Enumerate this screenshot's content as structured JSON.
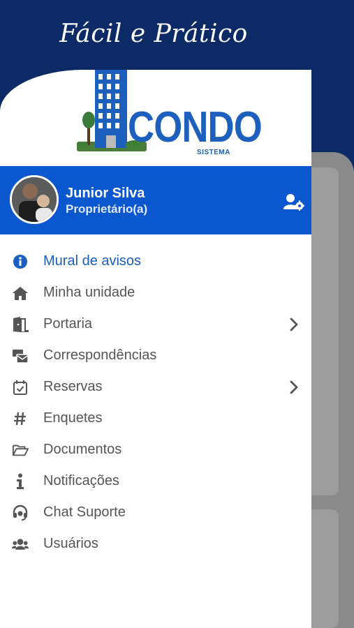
{
  "banner": {
    "tagline": "Fácil e Prático"
  },
  "logo": {
    "brand": "CONDO",
    "sub": "SISTEMA"
  },
  "user": {
    "name": "Junior Silva",
    "role": "Proprietário(a)"
  },
  "colors": {
    "navy": "#0b2a66",
    "profile_blue": "#0b57d0",
    "active": "#1a5fc4",
    "logo_blue": "#1d5fbd",
    "tree": "#3a7a3a"
  },
  "menu": {
    "items": [
      {
        "label": "Mural de avisos",
        "icon": "info-circle-icon",
        "active": true,
        "chevron": false
      },
      {
        "label": "Minha unidade",
        "icon": "home-icon",
        "active": false,
        "chevron": false
      },
      {
        "label": "Portaria",
        "icon": "door-open-icon",
        "active": false,
        "chevron": true
      },
      {
        "label": "Correspondências",
        "icon": "mail-bulk-icon",
        "active": false,
        "chevron": false
      },
      {
        "label": "Reservas",
        "icon": "calendar-check-icon",
        "active": false,
        "chevron": true
      },
      {
        "label": "Enquetes",
        "icon": "hashtag-icon",
        "active": false,
        "chevron": false
      },
      {
        "label": "Documentos",
        "icon": "folder-open-icon",
        "active": false,
        "chevron": false
      },
      {
        "label": "Notificações",
        "icon": "info-icon",
        "active": false,
        "chevron": false
      },
      {
        "label": "Chat Suporte",
        "icon": "headset-icon",
        "active": false,
        "chevron": false
      },
      {
        "label": "Usuários",
        "icon": "users-icon",
        "active": false,
        "chevron": false
      }
    ]
  }
}
